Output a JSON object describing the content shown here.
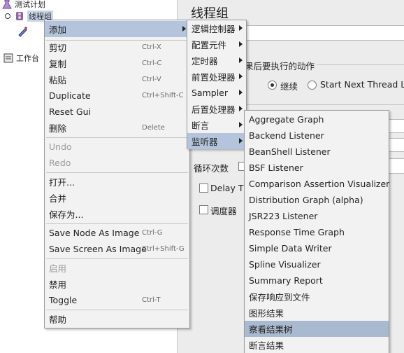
{
  "tree": {
    "items": [
      {
        "label": "测试计划"
      },
      {
        "label": "线程组"
      },
      {
        "label": "工作台"
      }
    ]
  },
  "panel": {
    "title": "线程组",
    "group_label_partial": "果后要执行的动作",
    "radio_continue": "继续",
    "radio_start_next": "Start Next Thread Loc",
    "loop_count_label": "循环次数",
    "delay_label": "Delay Th",
    "scheduler_label": "调度器"
  },
  "menu1": {
    "items": [
      {
        "label": "添加",
        "shortcut": ""
      },
      {
        "label": "剪切",
        "shortcut": "Ctrl-X"
      },
      {
        "label": "复制",
        "shortcut": "Ctrl-C"
      },
      {
        "label": "粘贴",
        "shortcut": "Ctrl-V"
      },
      {
        "label": "Duplicate",
        "shortcut": "Ctrl+Shift-C"
      },
      {
        "label": "Reset Gui",
        "shortcut": ""
      },
      {
        "label": "删除",
        "shortcut": "Delete"
      },
      {
        "label": "Undo",
        "shortcut": ""
      },
      {
        "label": "Redo",
        "shortcut": ""
      },
      {
        "label": "打开...",
        "shortcut": ""
      },
      {
        "label": "合并",
        "shortcut": ""
      },
      {
        "label": "保存为...",
        "shortcut": ""
      },
      {
        "label": "Save Node As Image",
        "shortcut": "Ctrl-G"
      },
      {
        "label": "Save Screen As Image",
        "shortcut": "Ctrl+Shift-G"
      },
      {
        "label": "启用",
        "shortcut": ""
      },
      {
        "label": "禁用",
        "shortcut": ""
      },
      {
        "label": "Toggle",
        "shortcut": "Ctrl-T"
      },
      {
        "label": "帮助",
        "shortcut": ""
      }
    ]
  },
  "menu2": {
    "items": [
      {
        "label": "逻辑控制器"
      },
      {
        "label": "配置元件"
      },
      {
        "label": "定时器"
      },
      {
        "label": "前置处理器"
      },
      {
        "label": "Sampler"
      },
      {
        "label": "后置处理器"
      },
      {
        "label": "断言"
      },
      {
        "label": "监听器"
      }
    ]
  },
  "menu3": {
    "items": [
      {
        "label": "Aggregate Graph"
      },
      {
        "label": "Backend Listener"
      },
      {
        "label": "BeanShell Listener"
      },
      {
        "label": "BSF Listener"
      },
      {
        "label": "Comparison Assertion Visualizer"
      },
      {
        "label": "Distribution Graph (alpha)"
      },
      {
        "label": "JSR223 Listener"
      },
      {
        "label": "Response Time Graph"
      },
      {
        "label": "Simple Data Writer"
      },
      {
        "label": "Spline Visualizer"
      },
      {
        "label": "Summary Report"
      },
      {
        "label": "保存响应到文件"
      },
      {
        "label": "图形结果"
      },
      {
        "label": "察看结果树"
      },
      {
        "label": "断言结果"
      }
    ]
  },
  "colors": {
    "menu_bg": "#f2f2f2",
    "highlight": "#b3c4dc",
    "disabled_text": "#9a9a9a",
    "shortcut_text": "#6b6b6b"
  }
}
